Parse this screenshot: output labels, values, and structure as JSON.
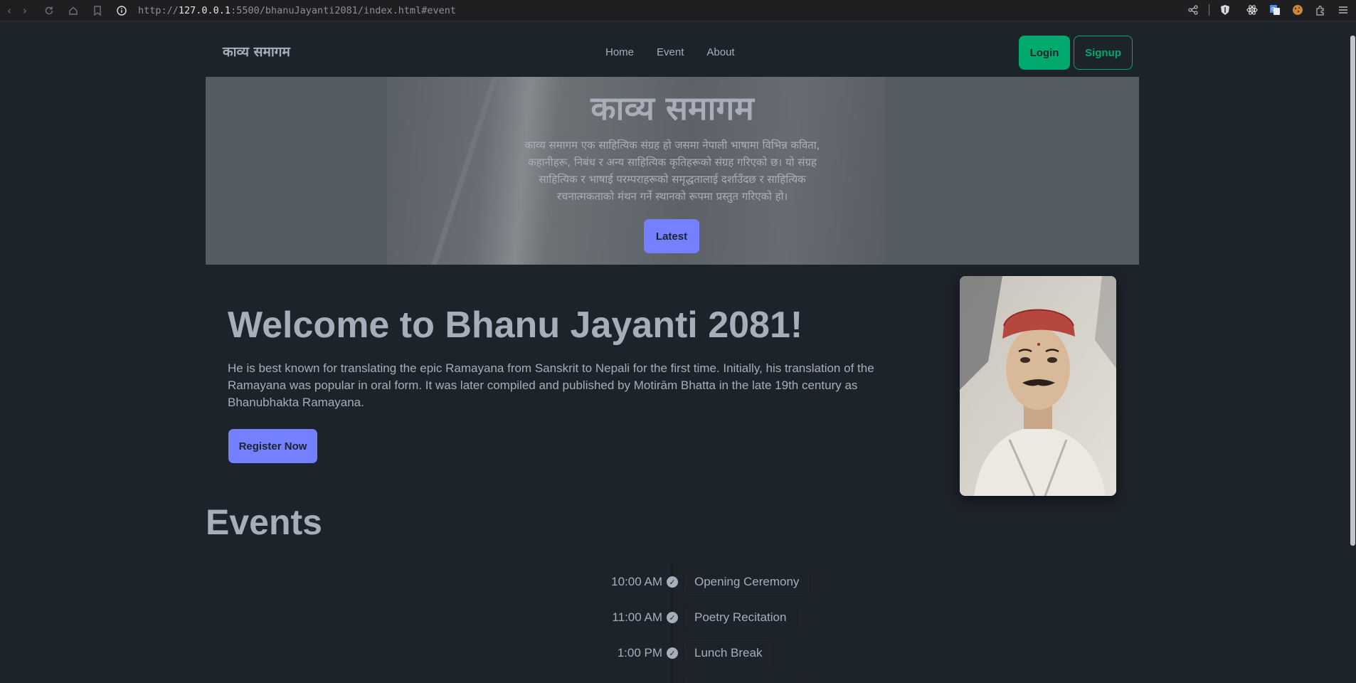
{
  "browser": {
    "url_scheme": "http://",
    "url_host": "127.0.0.1",
    "url_rest": ":5500/bhanuJayanti2081/index.html#event"
  },
  "nav": {
    "brand": "काव्य समागम",
    "links": [
      "Home",
      "Event",
      "About"
    ],
    "login_label": "Login",
    "signup_label": "Signup"
  },
  "hero": {
    "title": "काव्य समागम",
    "description": "काव्य समागम एक साहित्यिक संग्रह हो जसमा नेपाली भाषामा विभिन्न कविता, कहानीहरू, निबंध र अन्य साहित्यिक कृतिहरूको संग्रह गरिएको छ। यो संग्रह साहित्यिक र भाषाई परम्पराहरूको समृद्धतालाई दर्शाउँदछ र साहित्यिक रचनात्मकताको मंथन गर्ने स्थानको रूपमा प्रस्तुत गरिएको हो।",
    "button_label": "Latest"
  },
  "welcome": {
    "title": "Welcome to Bhanu Jayanti 2081!",
    "text": "He is best known for translating the epic Ramayana from Sanskrit to Nepali for the first time. Initially, his translation of the Ramayana was popular in oral form. It was later compiled and published by Motirām Bhatta in the late 19th century as Bhanubhakta Ramayana.",
    "button_label": "Register Now"
  },
  "events": {
    "title": "Events",
    "items": [
      {
        "time": "10:00 AM",
        "name": "Opening Ceremony"
      },
      {
        "time": "11:00 AM",
        "name": "Poetry Recitation"
      },
      {
        "time": "1:00 PM",
        "name": "Lunch Break"
      }
    ]
  },
  "colors": {
    "background": "#1d232a",
    "success": "#00a96e",
    "primary": "#7480ff",
    "text": "#a6adbb"
  }
}
